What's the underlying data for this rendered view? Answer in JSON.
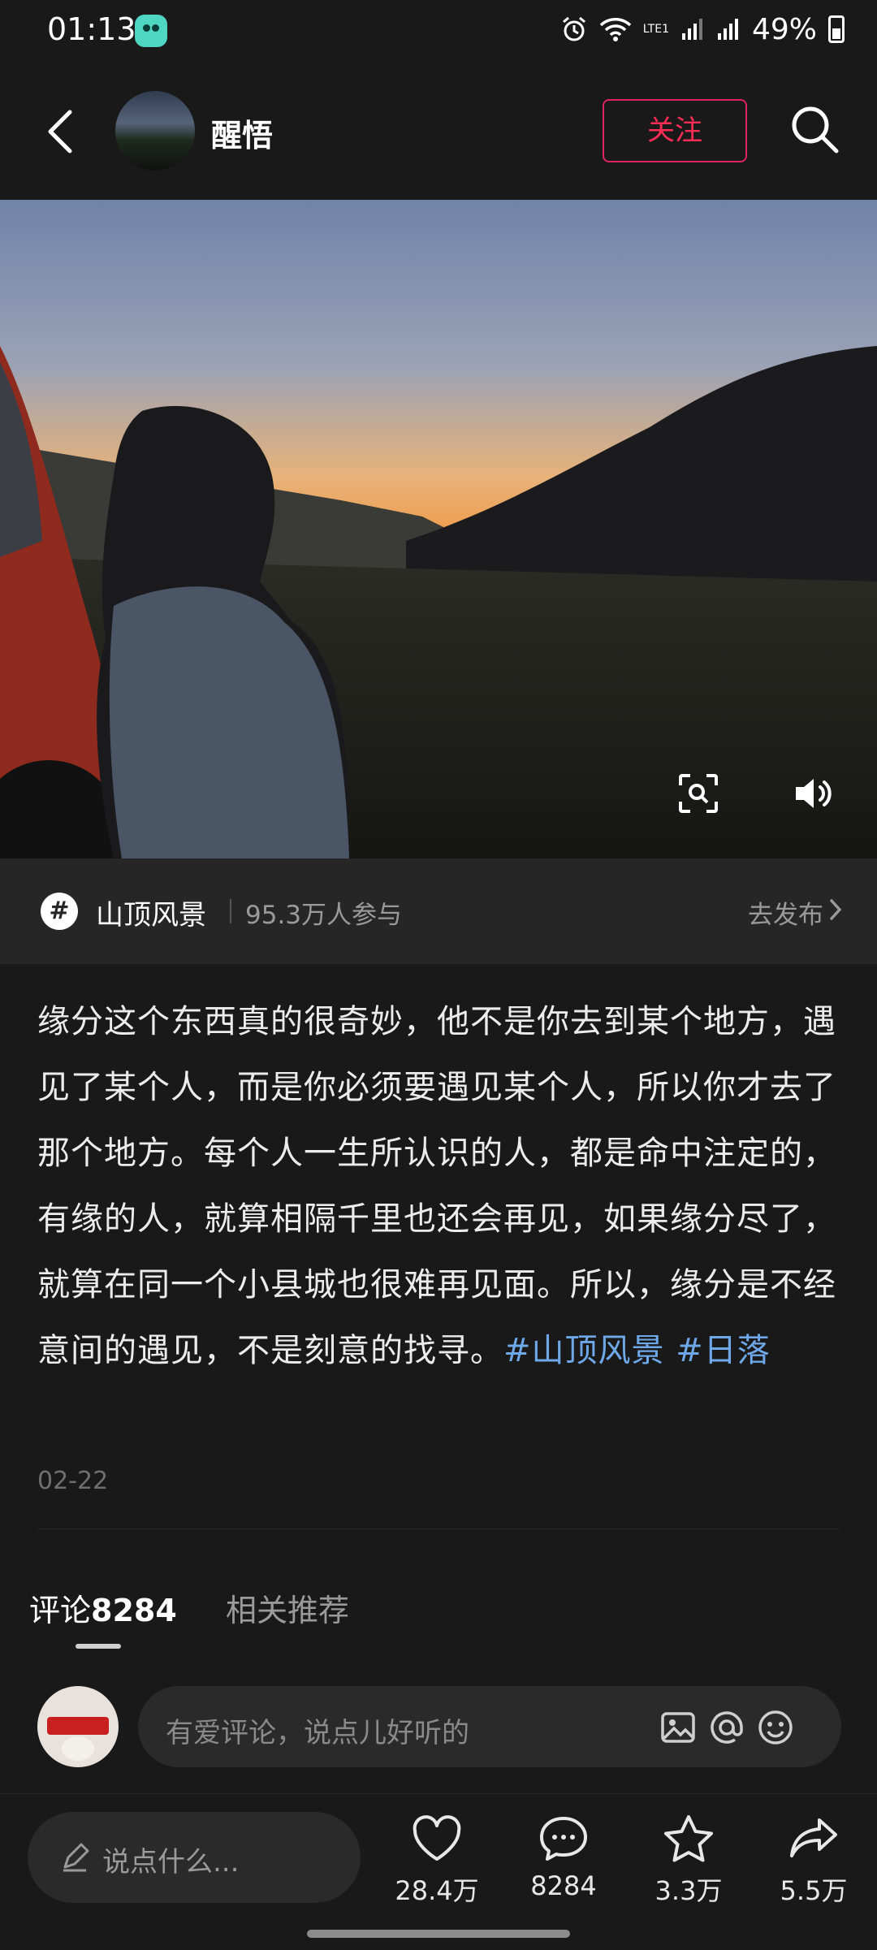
{
  "status_bar": {
    "time": "01:13",
    "battery": "49%",
    "network": "LTE1"
  },
  "header": {
    "author": "醒悟",
    "follow": "关注"
  },
  "topic": {
    "name": "山顶风景",
    "participants": "95.3万人参与",
    "publish": "去发布"
  },
  "post": {
    "text": "缘分这个东西真的很奇妙，他不是你去到某个地方，遇见了某个人，而是你必须要遇见某个人，所以你才去了那个地方。每个人一生所认识的人，都是命中注定的，有缘的人，就算相隔千里也还会再见，如果缘分尽了，就算在同一个小县城也很难再见面。所以，缘分是不经意间的遇见，不是刻意的找寻。",
    "tags": [
      "#山顶风景",
      "#日落"
    ],
    "date": "02-22"
  },
  "tabs": {
    "comments_label": "评论",
    "comments_count": "8284",
    "related": "相关推荐"
  },
  "comment_input": {
    "placeholder": "有爱评论，说点儿好听的"
  },
  "bottom_bar": {
    "say_placeholder": "说点什么...",
    "likes": "28.4万",
    "comments": "8284",
    "favorites": "3.3万",
    "shares": "5.5万"
  },
  "colors": {
    "accent": "#ff2d55",
    "tag": "#6ea8e8",
    "background": "#191919"
  }
}
